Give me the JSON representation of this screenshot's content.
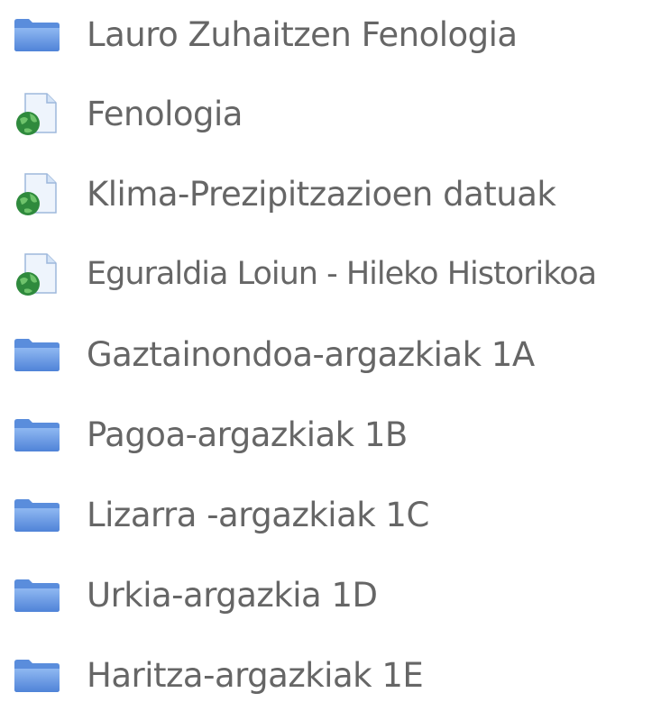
{
  "items": [
    {
      "label": "Lauro Zuhaitzen Fenologia",
      "icon": "folder-icon"
    },
    {
      "label": "Fenologia",
      "icon": "web-link-icon"
    },
    {
      "label": "Klima-Prezipitzazioen datuak",
      "icon": "web-link-icon"
    },
    {
      "label": "Eguraldia Loiun - Hileko Historikoa",
      "icon": "web-link-icon"
    },
    {
      "label": "Gaztainondoa-argazkiak 1A",
      "icon": "folder-icon"
    },
    {
      "label": "Pagoa-argazkiak 1B",
      "icon": "folder-icon"
    },
    {
      "label": "Lizarra -argazkiak 1C",
      "icon": "folder-icon"
    },
    {
      "label": "Urkia-argazkia 1D",
      "icon": "folder-icon"
    },
    {
      "label": "Haritza-argazkiak 1E",
      "icon": "folder-icon"
    }
  ],
  "colors": {
    "text": "#666666",
    "folder": "#6b9be6",
    "globe": "#2f8a3d"
  }
}
